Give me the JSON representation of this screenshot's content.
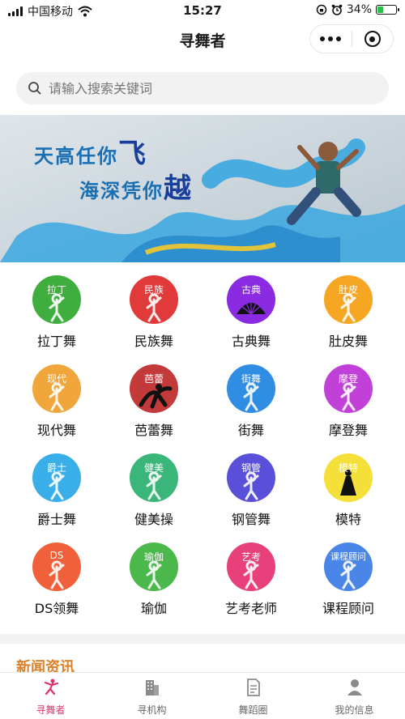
{
  "status_bar": {
    "carrier": "中国移动",
    "time": "15:27",
    "battery_percent": "34%",
    "battery_level": 0.34,
    "wifi_icon": "wifi-icon",
    "alarm_icon": "alarm-icon",
    "lock_icon": "orientation-lock-icon"
  },
  "nav": {
    "title": "寻舞者",
    "more_icon": "more-dots-icon",
    "close_icon": "target-close-icon"
  },
  "search": {
    "placeholder": "请输入搜索关键词",
    "icon": "search-icon"
  },
  "banner": {
    "line1_text": "天高任你",
    "line1_big": "飞",
    "line2_text": "海深凭你",
    "line2_big": "越",
    "colors": {
      "text_blue": "#1a6fb3",
      "splash_blue": "#3aa7e0",
      "splash_yellow": "#e2c43a"
    }
  },
  "categories": [
    {
      "label": "拉丁舞",
      "badge": "拉丁",
      "color": "#3fae3f",
      "icon": "latin-dancer-icon"
    },
    {
      "label": "民族舞",
      "badge": "民族",
      "color": "#e03a3a",
      "icon": "folk-dancer-icon"
    },
    {
      "label": "古典舞",
      "badge": "古典",
      "color": "#8a2be2",
      "icon": "fan-icon"
    },
    {
      "label": "肚皮舞",
      "badge": "肚皮",
      "color": "#f5a623",
      "icon": "belly-dancer-icon"
    },
    {
      "label": "现代舞",
      "badge": "现代",
      "color": "#f0a63a",
      "icon": "modern-dancer-icon"
    },
    {
      "label": "芭蕾舞",
      "badge": "芭蕾",
      "color": "#c33a3a",
      "icon": "ballet-dancer-icon"
    },
    {
      "label": "街舞",
      "badge": "街舞",
      "color": "#2f8de4",
      "icon": "street-dancer-icon"
    },
    {
      "label": "摩登舞",
      "badge": "摩登",
      "color": "#c040d8",
      "icon": "ballroom-couple-icon"
    },
    {
      "label": "爵士舞",
      "badge": "爵士",
      "color": "#3aaee8",
      "icon": "jazz-dancer-icon"
    },
    {
      "label": "健美操",
      "badge": "健美",
      "color": "#3ab67a",
      "icon": "aerobics-icon"
    },
    {
      "label": "钢管舞",
      "badge": "钢管",
      "color": "#5a4fd8",
      "icon": "pole-dancer-icon"
    },
    {
      "label": "模特",
      "badge": "模特",
      "color": "#f5e03a",
      "icon": "model-dress-icon"
    },
    {
      "label": "DS领舞",
      "badge": "DS",
      "color": "#f0603a",
      "icon": "ds-dancer-icon"
    },
    {
      "label": "瑜伽",
      "badge": "瑜伽",
      "color": "#4ab84a",
      "icon": "yoga-icon"
    },
    {
      "label": "艺考老师",
      "badge": "艺考",
      "color": "#e8407a",
      "icon": "art-teacher-icon"
    },
    {
      "label": "课程顾问",
      "badge": "课程顾问",
      "color": "#4a86e8",
      "icon": "course-advisor-icon"
    }
  ],
  "news": {
    "title": "新闻资讯"
  },
  "tabbar": [
    {
      "label": "寻舞者",
      "icon": "dancer-tab-icon",
      "active": true
    },
    {
      "label": "寻机构",
      "icon": "building-tab-icon",
      "active": false
    },
    {
      "label": "舞蹈圈",
      "icon": "document-tab-icon",
      "active": false
    },
    {
      "label": "我的信息",
      "icon": "user-tab-icon",
      "active": false
    }
  ],
  "colors": {
    "accent": "#e0306a",
    "news_title": "#d9822b"
  }
}
